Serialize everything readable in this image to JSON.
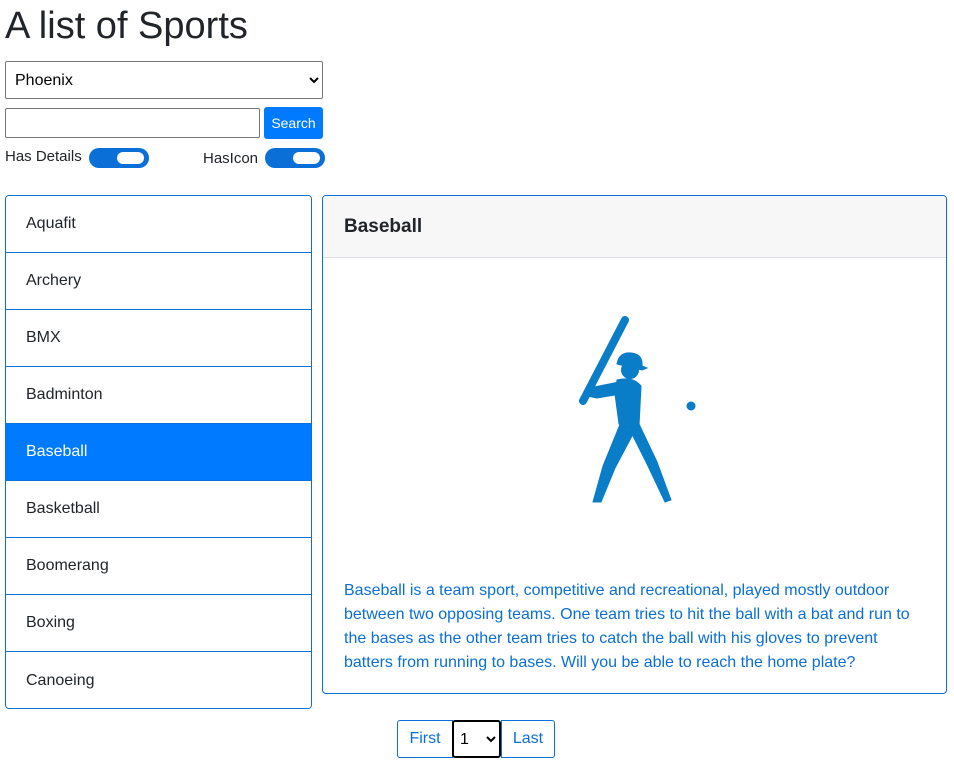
{
  "page": {
    "title": "A list of Sports"
  },
  "filters": {
    "city_selected": "Phoenix",
    "search_value": "",
    "search_placeholder": "",
    "search_button": "Search",
    "has_details_label": "Has Details",
    "has_details_on": true,
    "has_icon_label": "HasIcon",
    "has_icon_on": true
  },
  "sports": {
    "items": [
      {
        "label": "Aquafit",
        "active": false
      },
      {
        "label": "Archery",
        "active": false
      },
      {
        "label": "BMX",
        "active": false
      },
      {
        "label": "Badminton",
        "active": false
      },
      {
        "label": "Baseball",
        "active": true
      },
      {
        "label": "Basketball",
        "active": false
      },
      {
        "label": "Boomerang",
        "active": false
      },
      {
        "label": "Boxing",
        "active": false
      },
      {
        "label": "Canoeing",
        "active": false
      }
    ]
  },
  "detail": {
    "title": "Baseball",
    "icon": "baseball-player-icon",
    "description": "Baseball is a team sport, competitive and recreational, played mostly outdoor between two opposing teams. One team tries to hit the ball with a bat and run to the bases as the other team tries to catch the ball with his gloves to prevent batters from running to bases. Will you be able to reach the home plate?"
  },
  "pager": {
    "first_label": "First",
    "page_selected": "1",
    "last_label": "Last"
  },
  "colors": {
    "accent": "#007bff",
    "border": "#0a6fd6",
    "icon": "#0a7dc8"
  }
}
